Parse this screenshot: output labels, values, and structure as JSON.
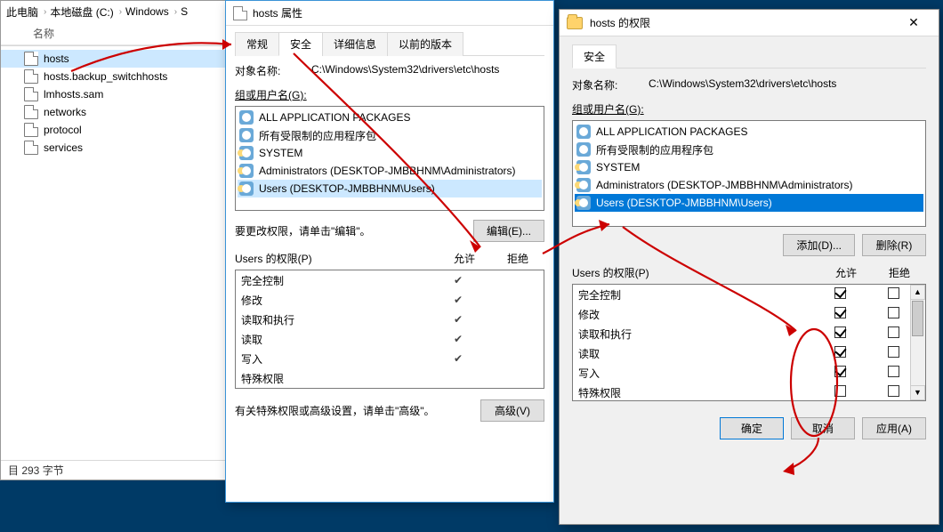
{
  "explorer": {
    "breadcrumb": [
      "此电脑",
      "本地磁盘 (C:)",
      "Windows",
      "S"
    ],
    "column_name": "名称",
    "files": [
      "hosts",
      "hosts.backup_switchhosts",
      "lmhosts.sam",
      "networks",
      "protocol",
      "services"
    ],
    "status": "目  293 字节"
  },
  "props": {
    "title": "hosts 属性",
    "tabs": [
      "常规",
      "安全",
      "详细信息",
      "以前的版本"
    ],
    "active_tab": 1,
    "object_name_label": "对象名称:",
    "object_name_value": "C:\\Windows\\System32\\drivers\\etc\\hosts",
    "group_label": "组或用户名(G):",
    "groups": [
      "ALL APPLICATION PACKAGES",
      "所有受限制的应用程序包",
      "SYSTEM",
      "Administrators (DESKTOP-JMBBHNM\\Administrators)",
      "Users (DESKTOP-JMBBHNM\\Users)"
    ],
    "selected_group_index": 4,
    "edit_hint": "要更改权限，请单击\"编辑\"。",
    "edit_button": "编辑(E)...",
    "perm_title": "Users 的权限(P)",
    "perm_cols": [
      "允许",
      "拒绝"
    ],
    "perms": [
      {
        "name": "完全控制",
        "allow": true,
        "deny": false
      },
      {
        "name": "修改",
        "allow": true,
        "deny": false
      },
      {
        "name": "读取和执行",
        "allow": true,
        "deny": false
      },
      {
        "name": "读取",
        "allow": true,
        "deny": false
      },
      {
        "name": "写入",
        "allow": true,
        "deny": false
      },
      {
        "name": "特殊权限",
        "allow": false,
        "deny": false
      }
    ],
    "adv_hint": "有关特殊权限或高级设置，请单击\"高级\"。",
    "adv_button": "高级(V)"
  },
  "permdlg": {
    "title": "hosts 的权限",
    "tabs": [
      "安全"
    ],
    "object_name_label": "对象名称:",
    "object_name_value": "C:\\Windows\\System32\\drivers\\etc\\hosts",
    "group_label": "组或用户名(G):",
    "groups": [
      "ALL APPLICATION PACKAGES",
      "所有受限制的应用程序包",
      "SYSTEM",
      "Administrators (DESKTOP-JMBBHNM\\Administrators)",
      "Users (DESKTOP-JMBBHNM\\Users)"
    ],
    "highlighted_group_index": 4,
    "add_button": "添加(D)...",
    "remove_button": "删除(R)",
    "perm_title": "Users 的权限(P)",
    "perm_cols": [
      "允许",
      "拒绝"
    ],
    "perms": [
      {
        "name": "完全控制",
        "allow": true,
        "deny": false
      },
      {
        "name": "修改",
        "allow": true,
        "deny": false
      },
      {
        "name": "读取和执行",
        "allow": true,
        "deny": false
      },
      {
        "name": "读取",
        "allow": true,
        "deny": false
      },
      {
        "name": "写入",
        "allow": true,
        "deny": false
      },
      {
        "name": "特殊权限",
        "allow": false,
        "deny": false
      }
    ],
    "ok_button": "确定",
    "cancel_button": "取消",
    "apply_button": "应用(A)"
  }
}
